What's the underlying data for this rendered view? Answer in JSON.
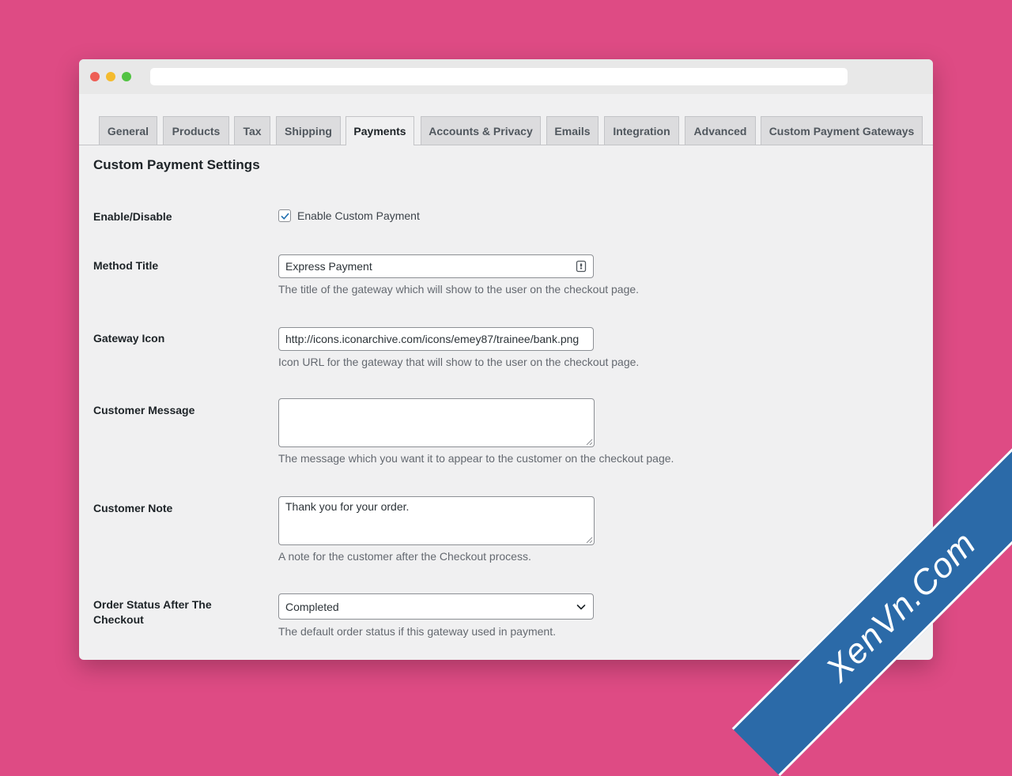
{
  "tabs": [
    {
      "label": "General"
    },
    {
      "label": "Products"
    },
    {
      "label": "Tax"
    },
    {
      "label": "Shipping"
    },
    {
      "label": "Payments",
      "active": true
    },
    {
      "label": "Accounts & Privacy"
    },
    {
      "label": "Emails"
    },
    {
      "label": "Integration"
    },
    {
      "label": "Advanced"
    },
    {
      "label": "Custom Payment Gateways"
    }
  ],
  "section_title": "Custom Payment Settings",
  "fields": {
    "enable": {
      "label": "Enable/Disable",
      "checkbox_label": "Enable Custom Payment",
      "checked": true
    },
    "method_title": {
      "label": "Method Title",
      "value": "Express Payment",
      "description": "The title of the gateway which will show to the user on the checkout page."
    },
    "gateway_icon": {
      "label": "Gateway Icon",
      "value": "http://icons.iconarchive.com/icons/emey87/trainee/bank.png",
      "description": "Icon URL for the gateway that will show to the user on the checkout page."
    },
    "customer_message": {
      "label": "Customer Message",
      "value": "",
      "description": "The message which you want it to appear to the customer on the checkout page."
    },
    "customer_note": {
      "label": "Customer Note",
      "value": "Thank you for your order.",
      "description": "A note for the customer after the Checkout process."
    },
    "order_status": {
      "label": "Order Status After The Checkout",
      "value": "Completed",
      "description": "The default order status if this gateway used in payment."
    }
  },
  "watermark": "XenVn.Com",
  "colors": {
    "background": "#de4b84",
    "panel": "#f0f0f1",
    "checkbox_check": "#2271b1",
    "watermark_band": "#2b6aa8"
  }
}
